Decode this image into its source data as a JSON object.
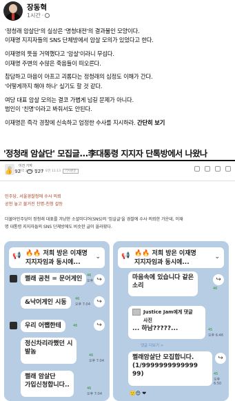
{
  "post": {
    "author": "장동혁",
    "time": "1시간",
    "lines": [
      "'정청래 암살단'의 실상은 '명청대전'의 결과물인 모양이다.",
      "이재명 지지자들의 SNS 단체방에서 암살 모의가 있었다고 한다.",
      "",
      "이재명의 뜻을 거역했다고 '암살'이라니 무섭다.",
      "이재명 주변의 수많은 죽음들이 떠오른다.",
      "",
      "참담하고 마음이 아프고 괴롭다는 정청래의 심정도 이해가 간다.",
      "'어떻게까지 해야 하나' 싶기도 할 것 같다.",
      "",
      "여당 대표 암살 모의는 결코 가볍게 넘길 문제가 아니다.",
      "범인이 '친명'이라고 봐줘서도 안된다.",
      "",
      "이재명은 즉각 경찰에 신속하고 엄정한 수사를 지시하라."
    ],
    "see_more": "간단히 보기"
  },
  "article": {
    "headline": "'정청래 암살단' 모집글...李대통령 지지자 단톡방에서 나왔나",
    "reporter": "이건 기자",
    "date": "입력 2026.05.17. 오전 11:13",
    "tag": "기사원문",
    "likes": "92",
    "comments": "127",
    "subheads": [
      "민주당, 서울경찰청에 수사 의뢰",
      "공천 놓고 불거진 친명-친청 갈등"
    ],
    "body": [
      "더불어민주당이 정청래 대표를 겨냥한 소셜미디어(SNS)의 '암살글'을 경찰에 수사 의뢰한 가운데, 이재",
      "명 대통령 지지자들의 SNS 단체방에도 비슷한 글이 올라왔다."
    ]
  },
  "chat_left": {
    "banner_line1": "🔥🔥 저희 방은 이재명",
    "banner_line2": "지지자임과 동시에...",
    "messages": [
      {
        "text": "쩔래 공천 = 문어게인",
        "count": "46",
        "time": "오후 7:03"
      },
      {
        "text": "&낙어게인 시동",
        "count": "46",
        "time": "오후 7:04"
      },
      {
        "text": "우리 어쨉한테",
        "count": "46",
        "time": ""
      },
      {
        "text": "정신차리라했던 시",
        "count": "",
        "time": ""
      },
      {
        "text": "발놈",
        "count": "46",
        "time": "오후 7:04"
      },
      {
        "text": "쩔래 암살단",
        "count": "",
        "time": ""
      },
      {
        "text": "가입신청합니다..",
        "count": "46",
        "time": "오후 7:04"
      }
    ]
  },
  "chat_right": {
    "banner_line1": "🔥🔥 저희 방은 이재명",
    "banner_line2": "지지자임과 동시에...",
    "messages": [
      {
        "text": "마음속에 있습니다 같은",
        "count": "",
        "time": ""
      },
      {
        "text": "소리",
        "count": "46",
        "time": ""
      },
      {
        "text": "Justice Jam에게 댓글",
        "count": "",
        "time": ""
      },
      {
        "text": "사진",
        "count": "",
        "time": ""
      },
      {
        "text": "... 하남?????...",
        "count": "45",
        "time": "오후 6:46"
      },
      {
        "text": "댓글 더보기 >",
        "count": "",
        "time": ""
      },
      {
        "text": "쩔래암살단 모집합니다.",
        "count": "",
        "time": ""
      },
      {
        "text": "(1/9999999999999",
        "count": "",
        "time": ""
      },
      {
        "text": "99)",
        "count": "45",
        "time": "오후 6:50"
      }
    ]
  }
}
